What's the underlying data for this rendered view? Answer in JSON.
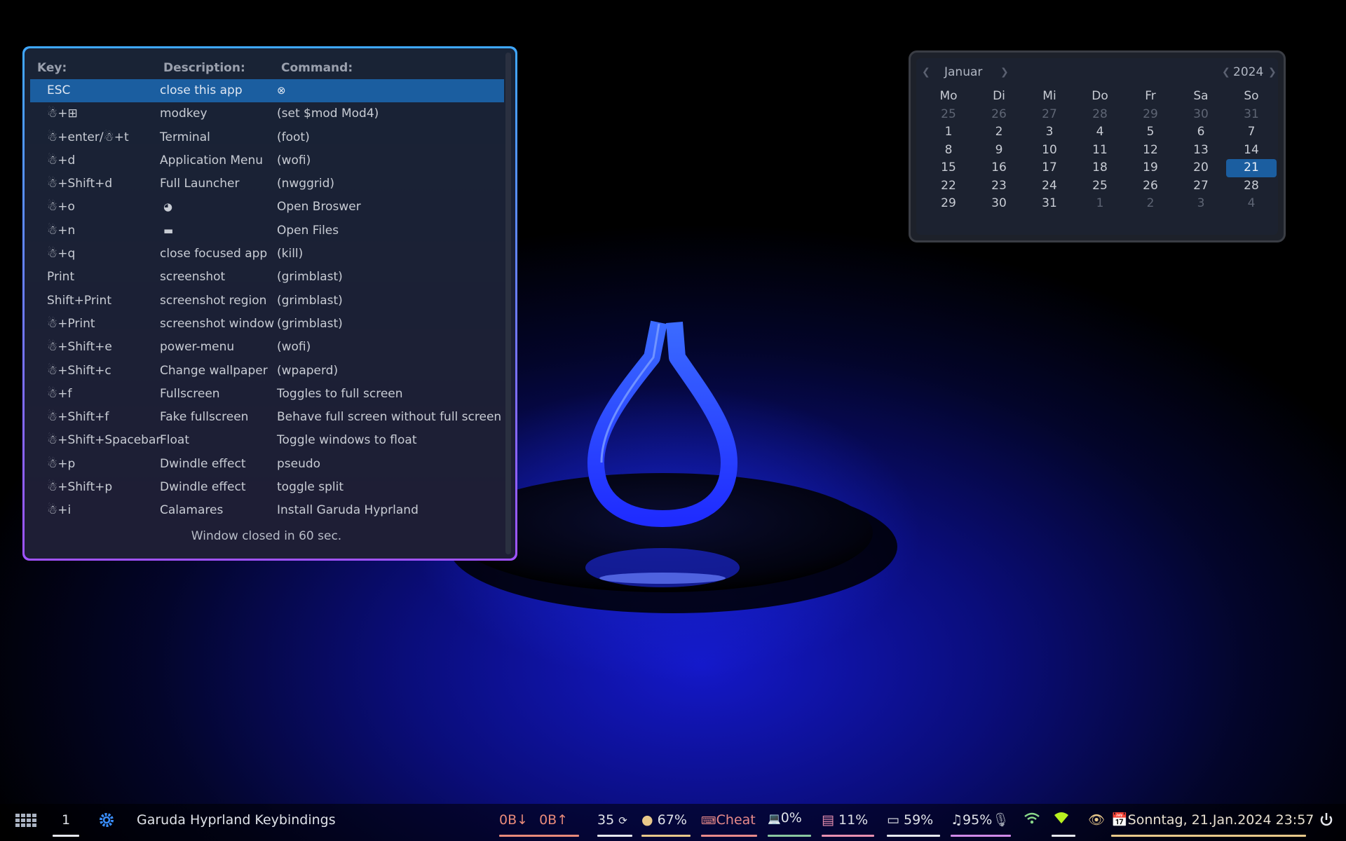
{
  "keybindings": {
    "headers": {
      "key": "Key:",
      "description": "Description:",
      "command": "Command:"
    },
    "rows": [
      {
        "key": "ESC",
        "description": "close this app",
        "command": "",
        "command_icon": "close-circle-icon",
        "selected": true
      },
      {
        "key": "☃+⊞",
        "description": "modkey",
        "command": "(set $mod Mod4)"
      },
      {
        "key": "☃+enter/☃+t",
        "description": "Terminal",
        "command": "(foot)"
      },
      {
        "key": "☃+d",
        "description": "Application Menu",
        "command": "(wofi)"
      },
      {
        "key": "☃+Shift+d",
        "description": "Full Launcher",
        "command": "(nwggrid)"
      },
      {
        "key": "☃+o",
        "description": "",
        "description_icon": "firefox-icon",
        "command": "Open Broswer"
      },
      {
        "key": "☃+n",
        "description": "",
        "description_icon": "folder-icon",
        "command": "Open Files"
      },
      {
        "key": "☃+q",
        "description": "close focused app",
        "command": "(kill)"
      },
      {
        "key": "Print",
        "description": "screenshot",
        "command": "(grimblast)"
      },
      {
        "key": "Shift+Print",
        "description": "screenshot region",
        "command": "(grimblast)"
      },
      {
        "key": "☃+Print",
        "description": "screenshot window",
        "command": "(grimblast)"
      },
      {
        "key": "☃+Shift+e",
        "description": "power-menu",
        "command": "(wofi)"
      },
      {
        "key": "☃+Shift+c",
        "description": "Change wallpaper",
        "command": "(wpaperd)"
      },
      {
        "key": "☃+f",
        "description": "Fullscreen",
        "command": "Toggles to full screen"
      },
      {
        "key": "☃+Shift+f",
        "description": "Fake fullscreen",
        "command": "Behave full screen without full screen"
      },
      {
        "key": "☃+Shift+Spacebar",
        "description": "Float",
        "command": "Toggle windows to float"
      },
      {
        "key": "☃+p",
        "description": "Dwindle effect",
        "command": "pseudo"
      },
      {
        "key": "☃+Shift+p",
        "description": "Dwindle effect",
        "command": "toggle split"
      },
      {
        "key": "☃+i",
        "description": "Calamares",
        "command": "Install Garuda Hyprland"
      }
    ],
    "footer": "Window closed in 60 sec."
  },
  "calendar": {
    "month": "Januar",
    "year": "2024",
    "weekdays": [
      "Mo",
      "Di",
      "Mi",
      "Do",
      "Fr",
      "Sa",
      "So"
    ],
    "weeks": [
      [
        "25",
        "26",
        "27",
        "28",
        "29",
        "30",
        "31"
      ],
      [
        "1",
        "2",
        "3",
        "4",
        "5",
        "6",
        "7"
      ],
      [
        "8",
        "9",
        "10",
        "11",
        "12",
        "13",
        "14"
      ],
      [
        "15",
        "16",
        "17",
        "18",
        "19",
        "20",
        "21"
      ],
      [
        "22",
        "23",
        "24",
        "25",
        "26",
        "27",
        "28"
      ],
      [
        "29",
        "30",
        "31",
        "1",
        "2",
        "3",
        "4"
      ]
    ],
    "today": "21"
  },
  "taskbar": {
    "workspace": "1",
    "window_title": "Garuda Hyprland Keybindings",
    "net_down": "0B",
    "net_up": "0B",
    "updates": "35",
    "brightness": "67%",
    "cheatsheet": "Cheat",
    "cpu": "0%",
    "disk": "11%",
    "battery": "59%",
    "volume": "95%",
    "datetime": "Sonntag, 21.Jan.2024 23:57"
  },
  "colors": {
    "accent": "#1b5ea0",
    "net_underline": "#e88a7a",
    "brightness_underline": "#e8c88a",
    "cheat_underline": "#e88a8a",
    "cpu_underline": "#8ac8a0",
    "disk_underline": "#e890b0",
    "volume_underline": "#d08ae8",
    "date_underline": "#e8c88a"
  }
}
